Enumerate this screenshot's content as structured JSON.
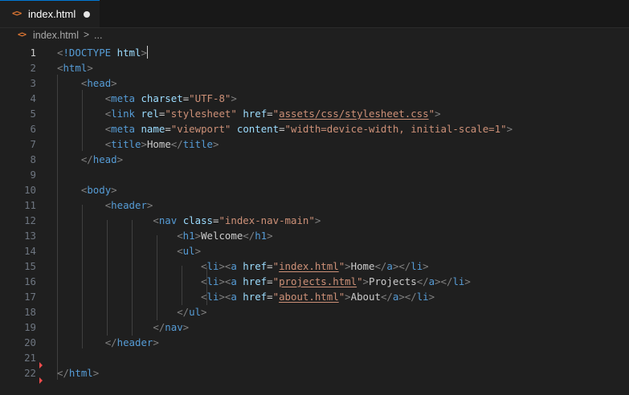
{
  "tab": {
    "icon": "html-file-icon",
    "icon_glyph": "<>",
    "label": "index.html",
    "dirty": true
  },
  "breadcrumb": {
    "icon_glyph": "<>",
    "file": "index.html",
    "separator": ">",
    "more": "..."
  },
  "colors": {
    "tag": "#569cd6",
    "attribute": "#9cdcfe",
    "string": "#ce9178",
    "bracket": "#808080",
    "text": "#cccccc",
    "icon": "#e37933"
  },
  "editor": {
    "active_line": 1,
    "lines": [
      {
        "n": "1",
        "tokens": [
          [
            "b",
            "<"
          ],
          [
            "t",
            "!DOCTYPE"
          ],
          [
            "x",
            " "
          ],
          [
            "a",
            "html"
          ],
          [
            "b",
            ">"
          ]
        ]
      },
      {
        "n": "2",
        "tokens": [
          [
            "b",
            "<"
          ],
          [
            "t",
            "html"
          ],
          [
            "b",
            ">"
          ]
        ]
      },
      {
        "n": "3",
        "tokens": [
          [
            "x",
            "    "
          ],
          [
            "b",
            "<"
          ],
          [
            "t",
            "head"
          ],
          [
            "b",
            ">"
          ]
        ]
      },
      {
        "n": "4",
        "tokens": [
          [
            "x",
            "        "
          ],
          [
            "b",
            "<"
          ],
          [
            "t",
            "meta"
          ],
          [
            "x",
            " "
          ],
          [
            "a",
            "charset"
          ],
          [
            "e",
            "="
          ],
          [
            "s",
            "\"UTF-8\""
          ],
          [
            "b",
            ">"
          ]
        ]
      },
      {
        "n": "5",
        "tokens": [
          [
            "x",
            "        "
          ],
          [
            "b",
            "<"
          ],
          [
            "t",
            "link"
          ],
          [
            "x",
            " "
          ],
          [
            "a",
            "rel"
          ],
          [
            "e",
            "="
          ],
          [
            "s",
            "\"stylesheet\""
          ],
          [
            "x",
            " "
          ],
          [
            "a",
            "href"
          ],
          [
            "e",
            "="
          ],
          [
            "s",
            "\""
          ],
          [
            "l",
            "assets/css/stylesheet.css"
          ],
          [
            "s",
            "\""
          ],
          [
            "b",
            ">"
          ]
        ]
      },
      {
        "n": "6",
        "tokens": [
          [
            "x",
            "        "
          ],
          [
            "b",
            "<"
          ],
          [
            "t",
            "meta"
          ],
          [
            "x",
            " "
          ],
          [
            "a",
            "name"
          ],
          [
            "e",
            "="
          ],
          [
            "s",
            "\"viewport\""
          ],
          [
            "x",
            " "
          ],
          [
            "a",
            "content"
          ],
          [
            "e",
            "="
          ],
          [
            "s",
            "\"width=device-width, initial-scale=1\""
          ],
          [
            "b",
            ">"
          ]
        ]
      },
      {
        "n": "7",
        "tokens": [
          [
            "x",
            "        "
          ],
          [
            "b",
            "<"
          ],
          [
            "t",
            "title"
          ],
          [
            "b",
            ">"
          ],
          [
            "x",
            "Home"
          ],
          [
            "b",
            "</"
          ],
          [
            "t",
            "title"
          ],
          [
            "b",
            ">"
          ]
        ]
      },
      {
        "n": "8",
        "tokens": [
          [
            "x",
            "    "
          ],
          [
            "b",
            "</"
          ],
          [
            "t",
            "head"
          ],
          [
            "b",
            ">"
          ]
        ]
      },
      {
        "n": "9",
        "tokens": []
      },
      {
        "n": "10",
        "tokens": [
          [
            "x",
            "    "
          ],
          [
            "b",
            "<"
          ],
          [
            "t",
            "body"
          ],
          [
            "b",
            ">"
          ]
        ]
      },
      {
        "n": "11",
        "tokens": [
          [
            "x",
            "        "
          ],
          [
            "b",
            "<"
          ],
          [
            "t",
            "header"
          ],
          [
            "b",
            ">"
          ]
        ]
      },
      {
        "n": "12",
        "tokens": [
          [
            "x",
            "                "
          ],
          [
            "b",
            "<"
          ],
          [
            "t",
            "nav"
          ],
          [
            "x",
            " "
          ],
          [
            "a",
            "class"
          ],
          [
            "e",
            "="
          ],
          [
            "s",
            "\"index-nav-main\""
          ],
          [
            "b",
            ">"
          ]
        ]
      },
      {
        "n": "13",
        "tokens": [
          [
            "x",
            "                    "
          ],
          [
            "b",
            "<"
          ],
          [
            "t",
            "h1"
          ],
          [
            "b",
            ">"
          ],
          [
            "x",
            "Welcome"
          ],
          [
            "b",
            "</"
          ],
          [
            "t",
            "h1"
          ],
          [
            "b",
            ">"
          ]
        ]
      },
      {
        "n": "14",
        "tokens": [
          [
            "x",
            "                    "
          ],
          [
            "b",
            "<"
          ],
          [
            "t",
            "ul"
          ],
          [
            "b",
            ">"
          ]
        ]
      },
      {
        "n": "15",
        "tokens": [
          [
            "x",
            "                        "
          ],
          [
            "b",
            "<"
          ],
          [
            "t",
            "li"
          ],
          [
            "b",
            "><"
          ],
          [
            "t",
            "a"
          ],
          [
            "x",
            " "
          ],
          [
            "a",
            "href"
          ],
          [
            "e",
            "="
          ],
          [
            "s",
            "\""
          ],
          [
            "l",
            "index.html"
          ],
          [
            "s",
            "\""
          ],
          [
            "b",
            ">"
          ],
          [
            "x",
            "Home"
          ],
          [
            "b",
            "</"
          ],
          [
            "t",
            "a"
          ],
          [
            "b",
            "></"
          ],
          [
            "t",
            "li"
          ],
          [
            "b",
            ">"
          ]
        ]
      },
      {
        "n": "16",
        "tokens": [
          [
            "x",
            "                        "
          ],
          [
            "b",
            "<"
          ],
          [
            "t",
            "li"
          ],
          [
            "b",
            "><"
          ],
          [
            "t",
            "a"
          ],
          [
            "x",
            " "
          ],
          [
            "a",
            "href"
          ],
          [
            "e",
            "="
          ],
          [
            "s",
            "\""
          ],
          [
            "l",
            "projects.html"
          ],
          [
            "s",
            "\""
          ],
          [
            "b",
            ">"
          ],
          [
            "x",
            "Projects"
          ],
          [
            "b",
            "</"
          ],
          [
            "t",
            "a"
          ],
          [
            "b",
            "></"
          ],
          [
            "t",
            "li"
          ],
          [
            "b",
            ">"
          ]
        ]
      },
      {
        "n": "17",
        "tokens": [
          [
            "x",
            "                        "
          ],
          [
            "b",
            "<"
          ],
          [
            "t",
            "li"
          ],
          [
            "b",
            "><"
          ],
          [
            "t",
            "a"
          ],
          [
            "x",
            " "
          ],
          [
            "a",
            "href"
          ],
          [
            "e",
            "="
          ],
          [
            "s",
            "\""
          ],
          [
            "l",
            "about.html"
          ],
          [
            "s",
            "\""
          ],
          [
            "b",
            ">"
          ],
          [
            "x",
            "About"
          ],
          [
            "b",
            "</"
          ],
          [
            "t",
            "a"
          ],
          [
            "b",
            "></"
          ],
          [
            "t",
            "li"
          ],
          [
            "b",
            ">"
          ]
        ]
      },
      {
        "n": "18",
        "tokens": [
          [
            "x",
            "                    "
          ],
          [
            "b",
            "</"
          ],
          [
            "t",
            "ul"
          ],
          [
            "b",
            ">"
          ]
        ]
      },
      {
        "n": "19",
        "tokens": [
          [
            "x",
            "                "
          ],
          [
            "b",
            "</"
          ],
          [
            "t",
            "nav"
          ],
          [
            "b",
            ">"
          ]
        ]
      },
      {
        "n": "20",
        "tokens": [
          [
            "x",
            "        "
          ],
          [
            "b",
            "</"
          ],
          [
            "t",
            "header"
          ],
          [
            "b",
            ">"
          ]
        ]
      },
      {
        "n": "21",
        "tokens": []
      },
      {
        "n": "22",
        "tokens": [
          [
            "b",
            "</"
          ],
          [
            "t",
            "html"
          ],
          [
            "b",
            ">"
          ]
        ]
      }
    ]
  }
}
